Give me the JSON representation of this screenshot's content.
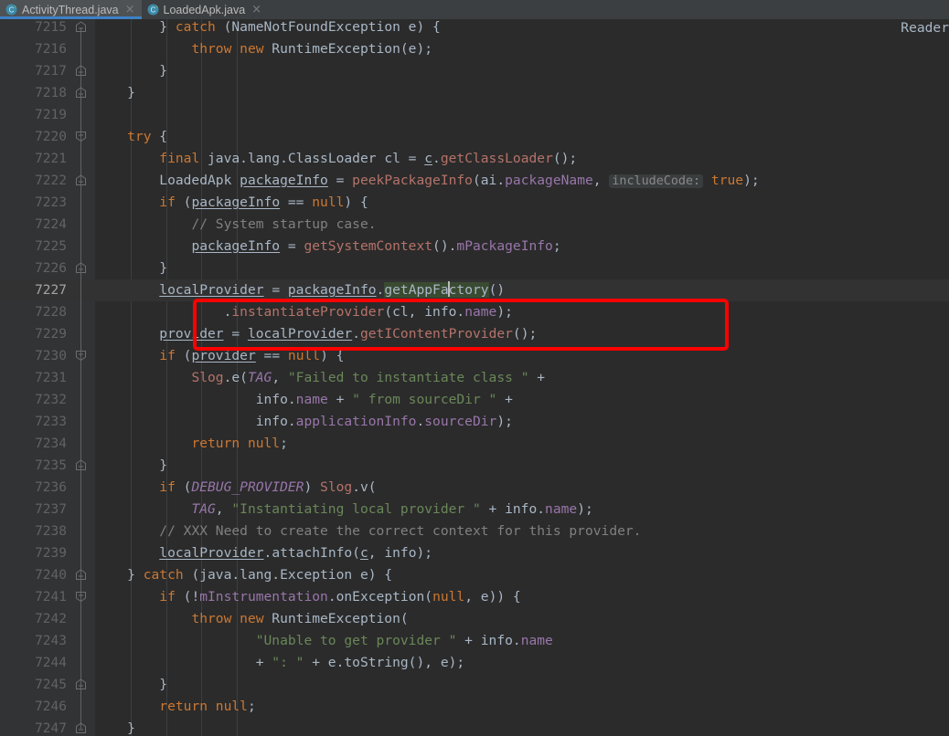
{
  "window": {
    "theme": "darcula",
    "bg": "#2B2B2B",
    "gutter_bg": "#313335",
    "caret_line_bg": "#323232",
    "accent": "#3C80C4",
    "annotation_color": "#FF0000"
  },
  "tabbar": {
    "tabs": [
      {
        "label": "ActivityThread.java",
        "icon": "java-class-icon",
        "close": "×",
        "active": true
      },
      {
        "label": "LoadedApk.java",
        "icon": "java-class-icon",
        "close": "×",
        "active": false
      }
    ]
  },
  "editor": {
    "first_line": 7215,
    "last_line": 7247,
    "caret_line": 7227,
    "right_label": "Reader",
    "inlay_hint": "includeCode:",
    "highlighted_identifier": "getAppFactory",
    "fold_markers": [
      {
        "line": 7215,
        "type": "collapse-up"
      },
      {
        "line": 7217,
        "type": "collapse-up"
      },
      {
        "line": 7218,
        "type": "collapse-up"
      },
      {
        "line": 7220,
        "type": "region-end"
      },
      {
        "line": 7222,
        "type": "collapse-up"
      },
      {
        "line": 7226,
        "type": "collapse-up"
      },
      {
        "line": 7230,
        "type": "region-end"
      },
      {
        "line": 7235,
        "type": "collapse-up"
      },
      {
        "line": 7240,
        "type": "collapse-up"
      },
      {
        "line": 7241,
        "type": "region-end"
      },
      {
        "line": 7245,
        "type": "collapse-up"
      },
      {
        "line": 7247,
        "type": "collapse-up"
      }
    ],
    "lines": [
      {
        "n": 7215,
        "text": "        } catch (NameNotFoundException e) {"
      },
      {
        "n": 7216,
        "text": "            throw new RuntimeException(e);"
      },
      {
        "n": 7217,
        "text": "        }"
      },
      {
        "n": 7218,
        "text": "    }"
      },
      {
        "n": 7219,
        "text": ""
      },
      {
        "n": 7220,
        "text": "    try {"
      },
      {
        "n": 7221,
        "text": "        final java.lang.ClassLoader cl = c.getClassLoader();"
      },
      {
        "n": 7222,
        "text": "        LoadedApk packageInfo = peekPackageInfo(ai.packageName, includeCode: true);"
      },
      {
        "n": 7223,
        "text": "        if (packageInfo == null) {"
      },
      {
        "n": 7224,
        "text": "            // System startup case."
      },
      {
        "n": 7225,
        "text": "            packageInfo = getSystemContext().mPackageInfo;"
      },
      {
        "n": 7226,
        "text": "        }"
      },
      {
        "n": 7227,
        "text": "        localProvider = packageInfo.getAppFactory()"
      },
      {
        "n": 7228,
        "text": "                .instantiateProvider(cl, info.name);"
      },
      {
        "n": 7229,
        "text": "        provider = localProvider.getIContentProvider();"
      },
      {
        "n": 7230,
        "text": "        if (provider == null) {"
      },
      {
        "n": 7231,
        "text": "            Slog.e(TAG, \"Failed to instantiate class \" +"
      },
      {
        "n": 7232,
        "text": "                    info.name + \" from sourceDir \" +"
      },
      {
        "n": 7233,
        "text": "                    info.applicationInfo.sourceDir);"
      },
      {
        "n": 7234,
        "text": "            return null;"
      },
      {
        "n": 7235,
        "text": "        }"
      },
      {
        "n": 7236,
        "text": "        if (DEBUG_PROVIDER) Slog.v("
      },
      {
        "n": 7237,
        "text": "            TAG, \"Instantiating local provider \" + info.name);"
      },
      {
        "n": 7238,
        "text": "        // XXX Need to create the correct context for this provider."
      },
      {
        "n": 7239,
        "text": "        localProvider.attachInfo(c, info);"
      },
      {
        "n": 7240,
        "text": "    } catch (java.lang.Exception e) {"
      },
      {
        "n": 7241,
        "text": "        if (!mInstrumentation.onException(null, e)) {"
      },
      {
        "n": 7242,
        "text": "            throw new RuntimeException("
      },
      {
        "n": 7243,
        "text": "                    \"Unable to get provider \" + info.name"
      },
      {
        "n": 7244,
        "text": "                    + \": \" + e.toString(), e);"
      },
      {
        "n": 7245,
        "text": "        }"
      },
      {
        "n": 7246,
        "text": "        return null;"
      },
      {
        "n": 7247,
        "text": "    }"
      }
    ],
    "tokens": {
      "7215": [
        [
          "plain",
          "        } "
        ],
        [
          "kw",
          "catch"
        ],
        [
          "plain",
          " (NameNotFoundException e) {"
        ]
      ],
      "7216": [
        [
          "plain",
          "            "
        ],
        [
          "kw",
          "throw new"
        ],
        [
          "plain",
          " RuntimeException(e);"
        ]
      ],
      "7217": [
        [
          "plain",
          "        }"
        ]
      ],
      "7218": [
        [
          "plain",
          "    }"
        ]
      ],
      "7219": [
        [
          "plain",
          ""
        ]
      ],
      "7220": [
        [
          "plain",
          "    "
        ],
        [
          "kw",
          "try"
        ],
        [
          "plain",
          " {"
        ]
      ],
      "7221": [
        [
          "plain",
          "        "
        ],
        [
          "kw",
          "final"
        ],
        [
          "plain",
          " java.lang.ClassLoader cl = "
        ],
        [
          "lvar",
          "c"
        ],
        [
          "plain",
          "."
        ],
        [
          "meth",
          "getClassLoader"
        ],
        [
          "plain",
          "();"
        ]
      ],
      "7222": [
        [
          "plain",
          "        LoadedApk "
        ],
        [
          "lvar",
          "packageInfo"
        ],
        [
          "plain",
          " = "
        ],
        [
          "meth",
          "peekPackageInfo"
        ],
        [
          "plain",
          "(ai."
        ],
        [
          "fld",
          "packageName"
        ],
        [
          "plain",
          ", "
        ],
        [
          "hint",
          "includeCode:"
        ],
        [
          "plain",
          " "
        ],
        [
          "kw",
          "true"
        ],
        [
          "plain",
          ");"
        ]
      ],
      "7223": [
        [
          "plain",
          "        "
        ],
        [
          "kw",
          "if"
        ],
        [
          "plain",
          " ("
        ],
        [
          "lvar",
          "packageInfo"
        ],
        [
          "plain",
          " == "
        ],
        [
          "kw",
          "null"
        ],
        [
          "plain",
          ") {"
        ]
      ],
      "7224": [
        [
          "plain",
          "            "
        ],
        [
          "com",
          "// System startup case."
        ]
      ],
      "7225": [
        [
          "plain",
          "            "
        ],
        [
          "lvar",
          "packageInfo"
        ],
        [
          "plain",
          " = "
        ],
        [
          "meth",
          "getSystemContext"
        ],
        [
          "plain",
          "()."
        ],
        [
          "fld",
          "mPackageInfo"
        ],
        [
          "plain",
          ";"
        ]
      ],
      "7226": [
        [
          "plain",
          "        }"
        ]
      ],
      "7227": [
        [
          "plain",
          "        "
        ],
        [
          "lvar",
          "localProvider"
        ],
        [
          "plain",
          " = "
        ],
        [
          "lvar",
          "packageInfo"
        ],
        [
          "plain",
          "."
        ],
        [
          "idhl",
          "getAppFactory"
        ],
        [
          "plain",
          "()"
        ]
      ],
      "7228": [
        [
          "plain",
          "                ."
        ],
        [
          "meth",
          "instantiateProvider"
        ],
        [
          "plain",
          "(cl, info."
        ],
        [
          "fld",
          "name"
        ],
        [
          "plain",
          ");"
        ]
      ],
      "7229": [
        [
          "plain",
          "        "
        ],
        [
          "lvar",
          "provider"
        ],
        [
          "plain",
          " = "
        ],
        [
          "lvar",
          "localProvider"
        ],
        [
          "plain",
          "."
        ],
        [
          "meth",
          "getIContentProvider"
        ],
        [
          "plain",
          "();"
        ]
      ],
      "7230": [
        [
          "plain",
          "        "
        ],
        [
          "kw",
          "if"
        ],
        [
          "plain",
          " ("
        ],
        [
          "lvar",
          "provider"
        ],
        [
          "plain",
          " == "
        ],
        [
          "kw",
          "null"
        ],
        [
          "plain",
          ") {"
        ]
      ],
      "7231": [
        [
          "plain",
          "            "
        ],
        [
          "meth",
          "Slog"
        ],
        [
          "plain",
          ".e("
        ],
        [
          "sfld",
          "TAG"
        ],
        [
          "plain",
          ", "
        ],
        [
          "str",
          "\"Failed to instantiate class \""
        ],
        [
          "plain",
          " +"
        ]
      ],
      "7232": [
        [
          "plain",
          "                    info."
        ],
        [
          "fld",
          "name"
        ],
        [
          "plain",
          " + "
        ],
        [
          "str",
          "\" from sourceDir \""
        ],
        [
          "plain",
          " +"
        ]
      ],
      "7233": [
        [
          "plain",
          "                    info."
        ],
        [
          "fld",
          "applicationInfo"
        ],
        [
          "plain",
          "."
        ],
        [
          "fld",
          "sourceDir"
        ],
        [
          "plain",
          ");"
        ]
      ],
      "7234": [
        [
          "plain",
          "            "
        ],
        [
          "kw",
          "return null"
        ],
        [
          "plain",
          ";"
        ]
      ],
      "7235": [
        [
          "plain",
          "        }"
        ]
      ],
      "7236": [
        [
          "plain",
          "        "
        ],
        [
          "kw",
          "if"
        ],
        [
          "plain",
          " ("
        ],
        [
          "sfld",
          "DEBUG_PROVIDER"
        ],
        [
          "plain",
          ") "
        ],
        [
          "meth",
          "Slog"
        ],
        [
          "plain",
          ".v("
        ]
      ],
      "7237": [
        [
          "plain",
          "            "
        ],
        [
          "sfld",
          "TAG"
        ],
        [
          "plain",
          ", "
        ],
        [
          "str",
          "\"Instantiating local provider \""
        ],
        [
          "plain",
          " + info."
        ],
        [
          "fld",
          "name"
        ],
        [
          "plain",
          ");"
        ]
      ],
      "7238": [
        [
          "plain",
          "        "
        ],
        [
          "com",
          "// XXX Need to create the correct context for this provider."
        ]
      ],
      "7239": [
        [
          "plain",
          "        "
        ],
        [
          "lvar",
          "localProvider"
        ],
        [
          "plain",
          ".attachInfo("
        ],
        [
          "lvar",
          "c"
        ],
        [
          "plain",
          ", info);"
        ]
      ],
      "7240": [
        [
          "plain",
          "    } "
        ],
        [
          "kw",
          "catch"
        ],
        [
          "plain",
          " (java.lang.Exception e) {"
        ]
      ],
      "7241": [
        [
          "plain",
          "        "
        ],
        [
          "kw",
          "if"
        ],
        [
          "plain",
          " (!"
        ],
        [
          "fld",
          "mInstrumentation"
        ],
        [
          "plain",
          ".onException("
        ],
        [
          "kw",
          "null"
        ],
        [
          "plain",
          ", e)) {"
        ]
      ],
      "7242": [
        [
          "plain",
          "            "
        ],
        [
          "kw",
          "throw new"
        ],
        [
          "plain",
          " RuntimeException("
        ]
      ],
      "7243": [
        [
          "plain",
          "                    "
        ],
        [
          "str",
          "\"Unable to get provider \""
        ],
        [
          "plain",
          " + info."
        ],
        [
          "fld",
          "name"
        ]
      ],
      "7244": [
        [
          "plain",
          "                    + "
        ],
        [
          "str",
          "\": \""
        ],
        [
          "plain",
          " + e.toString(), e);"
        ]
      ],
      "7245": [
        [
          "plain",
          "        }"
        ]
      ],
      "7246": [
        [
          "plain",
          "        "
        ],
        [
          "kw",
          "return null"
        ],
        [
          "plain",
          ";"
        ]
      ],
      "7247": [
        [
          "plain",
          "    }"
        ]
      ]
    }
  }
}
